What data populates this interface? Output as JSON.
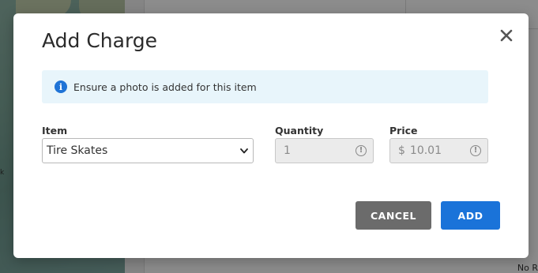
{
  "background": {
    "map_label": "k",
    "bottom_text": "No R"
  },
  "modal": {
    "title": "Add Charge",
    "close_icon": "close-icon",
    "info": {
      "icon": "info-icon",
      "text": "Ensure a photo is added for this item",
      "color": "#1f73d6"
    },
    "fields": {
      "item": {
        "label": "Item",
        "value": "Tire Skates"
      },
      "quantity": {
        "label": "Quantity",
        "value": "1"
      },
      "price": {
        "label": "Price",
        "currency": "$",
        "value": "10.01"
      }
    },
    "buttons": {
      "cancel": "CANCEL",
      "add": "ADD"
    },
    "colors": {
      "primary": "#1a73d9",
      "secondary": "#6b6b6b",
      "banner_bg": "#e8f5fb"
    }
  }
}
